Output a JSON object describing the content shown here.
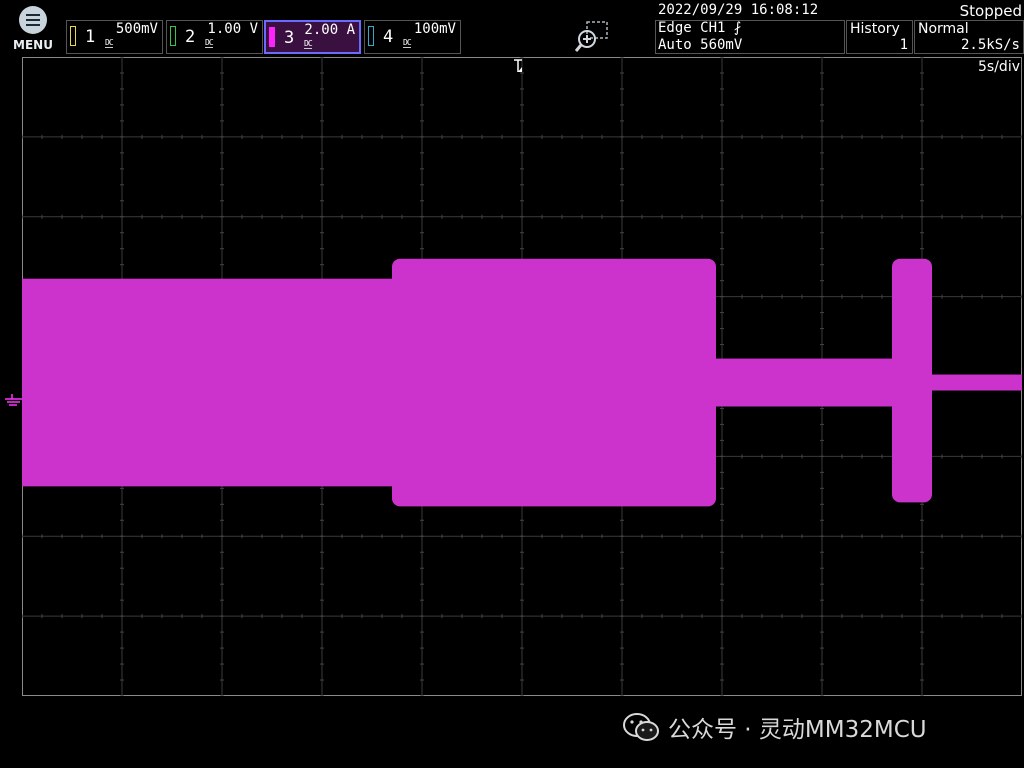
{
  "menu": {
    "label": "MENU"
  },
  "channels": [
    {
      "num": "1",
      "value": "500mV",
      "coupling": "DC",
      "color": "#e8d84a",
      "active": false
    },
    {
      "num": "2",
      "value": "1.00 V",
      "coupling": "DC",
      "color": "#3cc44a",
      "active": false
    },
    {
      "num": "3",
      "value": "2.00 A",
      "coupling": "DC",
      "color": "#ff22ff",
      "active": true
    },
    {
      "num": "4",
      "value": "100mV",
      "coupling": "DC",
      "color": "#3aa6c8",
      "active": false
    }
  ],
  "status": {
    "date": "2022/09/29 16:08:12",
    "run_state": "Stopped"
  },
  "trigger": {
    "line1": "Edge CH1 ⨏",
    "line2": "Auto 560mV"
  },
  "history": {
    "label": "History",
    "value": "1"
  },
  "acquisition": {
    "mode": "Normal",
    "rate": "2.5kS/s"
  },
  "timebase": "5s/div",
  "icons": {
    "menu": "hamburger-menu-icon",
    "zoom": "zoom-in-icon",
    "trigger": "trigger-position-icon",
    "ground": "ground-reference-icon",
    "watermark": "wechat-icon"
  },
  "waveform": {
    "channel": "3",
    "color": "#cc33cc",
    "time_per_div_s": 5,
    "current_per_div_a": 2.0,
    "segments": [
      {
        "t_div": [
          0.0,
          3.7
        ],
        "low_div": -1.1,
        "high_div": 1.5
      },
      {
        "t_div": [
          3.7,
          6.94
        ],
        "low_div": -1.35,
        "high_div": 1.75
      },
      {
        "t_div": [
          6.94,
          8.7
        ],
        "low_div": -0.1,
        "high_div": 0.5
      },
      {
        "t_div": [
          8.7,
          9.1
        ],
        "low_div": -1.3,
        "high_div": 1.75
      },
      {
        "t_div": [
          9.1,
          10.0
        ],
        "low_div": 0.1,
        "high_div": 0.3
      }
    ]
  },
  "watermark": {
    "text": "公众号 · 灵动MM32MCU"
  }
}
